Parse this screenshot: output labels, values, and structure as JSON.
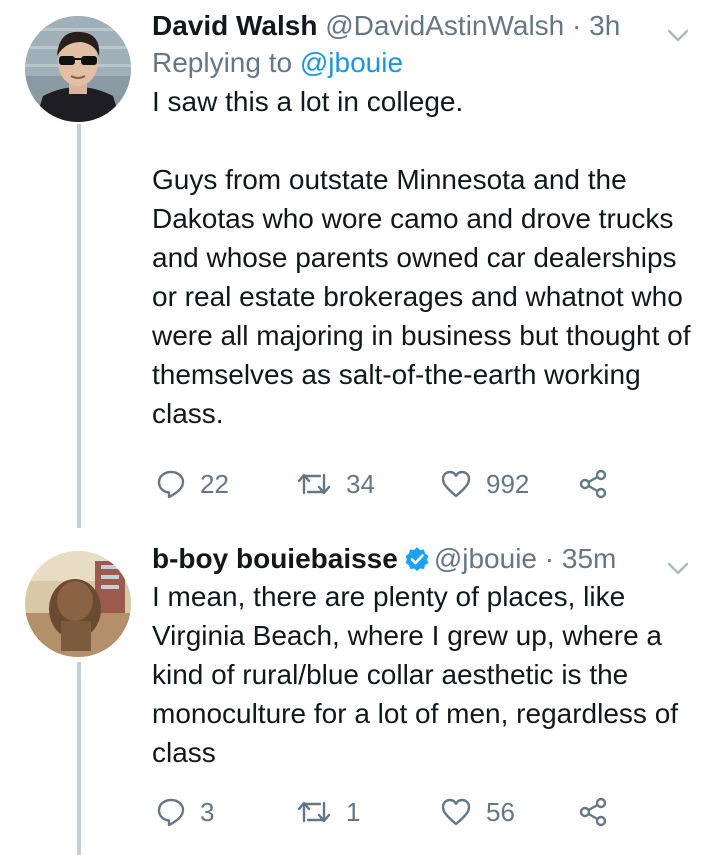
{
  "tweets": [
    {
      "author_name": "David Walsh",
      "handle": "@DavidAstinWalsh",
      "separator": " · ",
      "time": "3h",
      "reply_prefix": "Replying to ",
      "reply_to": "@jbouie",
      "text": "I saw this a lot in college.\n\nGuys from outstate Minnesota and the Dakotas who wore camo and drove trucks and whose parents owned car dealerships or real estate brokerages and whatnot who were all majoring in business but thought of themselves as salt-of-the-earth working class.",
      "counts": {
        "replies": "22",
        "retweets": "34",
        "likes": "992"
      }
    },
    {
      "author_name": "b-boy bouiebaisse",
      "verified": true,
      "handle": "@jbouie",
      "separator": " · ",
      "time": "35m",
      "text": "I mean, there are plenty of places, like Virginia Beach, where I grew up, where a kind of rural/blue collar aesthetic is the monoculture for a lot of men, regardless of class",
      "counts": {
        "replies": "3",
        "retweets": "1",
        "likes": "56"
      }
    }
  ],
  "icons": {
    "reply": "reply-icon",
    "retweet": "retweet-icon",
    "like": "heart-icon",
    "share": "share-icon",
    "more": "chevron-down-icon",
    "verified": "verified-badge-icon"
  },
  "colors": {
    "text": "#14171a",
    "secondary": "#657786",
    "link": "#1b95e0",
    "verified": "#1da1f2",
    "thread_line": "#c4cfd6"
  }
}
